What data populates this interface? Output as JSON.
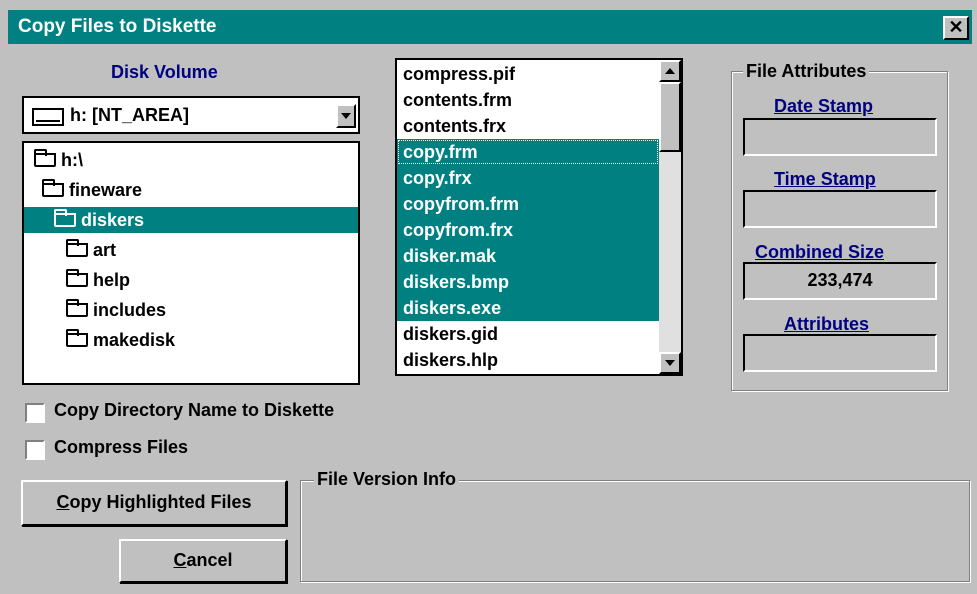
{
  "window": {
    "title": "Copy Files to Diskette",
    "close_glyph": "✕"
  },
  "disk_volume": {
    "label": "Disk Volume",
    "drive_value": "h: [NT_AREA]",
    "drive_icon": "drive-icon"
  },
  "tree": {
    "items": [
      {
        "label": "h:\\",
        "icon": "open-folder-icon",
        "selected": false
      },
      {
        "label": "fineware",
        "icon": "open-folder-icon",
        "selected": false
      },
      {
        "label": "diskers",
        "icon": "open-folder-icon",
        "selected": true
      },
      {
        "label": "art",
        "icon": "folder-icon",
        "selected": false
      },
      {
        "label": "help",
        "icon": "folder-icon",
        "selected": false
      },
      {
        "label": "includes",
        "icon": "folder-icon",
        "selected": false
      },
      {
        "label": "makedisk",
        "icon": "folder-icon",
        "selected": false
      }
    ]
  },
  "files": {
    "items": [
      {
        "name": "compress.pif",
        "selected": false
      },
      {
        "name": "contents.frm",
        "selected": false
      },
      {
        "name": "contents.frx",
        "selected": false
      },
      {
        "name": "copy.frm",
        "selected": true
      },
      {
        "name": "copy.frx",
        "selected": true
      },
      {
        "name": "copyfrom.frm",
        "selected": true
      },
      {
        "name": "copyfrom.frx",
        "selected": true
      },
      {
        "name": "disker.mak",
        "selected": true
      },
      {
        "name": "diskers.bmp",
        "selected": true
      },
      {
        "name": "diskers.exe",
        "selected": true
      },
      {
        "name": "diskers.gid",
        "selected": false
      },
      {
        "name": "diskers.hlp",
        "selected": false
      }
    ]
  },
  "file_attributes": {
    "title": "File Attributes",
    "date_stamp_label": "Date Stamp",
    "date_stamp_value": "",
    "time_stamp_label": "Time Stamp",
    "time_stamp_value": "",
    "combined_size_label": "Combined Size",
    "combined_size_value": "233,474",
    "attributes_label": "Attributes",
    "attributes_value": ""
  },
  "options": {
    "copy_dir_name_label": "Copy Directory Name to Diskette",
    "copy_dir_name_checked": false,
    "compress_label": "Compress Files",
    "compress_checked": false
  },
  "version_info": {
    "title": "File Version Info"
  },
  "buttons": {
    "copy_mnemonic": "C",
    "copy_rest": "opy Highlighted Files",
    "cancel_mnemonic": "C",
    "cancel_rest": "ancel"
  },
  "colors": {
    "accent": "#008080",
    "label_blue": "#000080",
    "face": "#c0c0c0"
  }
}
